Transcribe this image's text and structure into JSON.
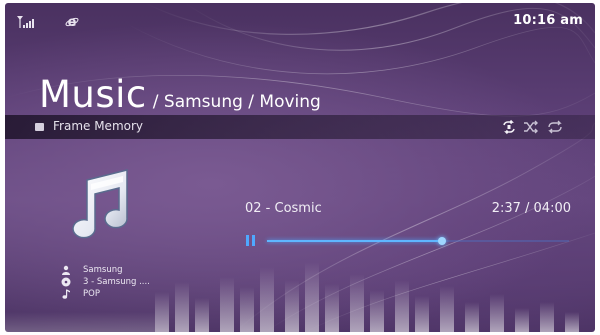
{
  "status": {
    "clock": "10:16 am",
    "signal_icon": "signal-bars-icon",
    "network_icon": "internet-explorer-icon"
  },
  "header": {
    "title": "Music",
    "path": "/ Samsung / Moving"
  },
  "source": {
    "label": "Frame Memory",
    "icon": "memory-card-icon"
  },
  "controls": {
    "repeat_icon": "repeat-one-icon",
    "shuffle_icon": "shuffle-icon",
    "repeat_all_icon": "repeat-all-icon"
  },
  "track": {
    "title": "02 - Cosmic",
    "time": "2:37 / 04:00",
    "progress": 0.58
  },
  "info": {
    "artist": "Samsung",
    "album": "3 - Samsung ....",
    "genre": "POP"
  },
  "colors": {
    "accent": "#4fa8ff",
    "background": "#5c3f76"
  }
}
